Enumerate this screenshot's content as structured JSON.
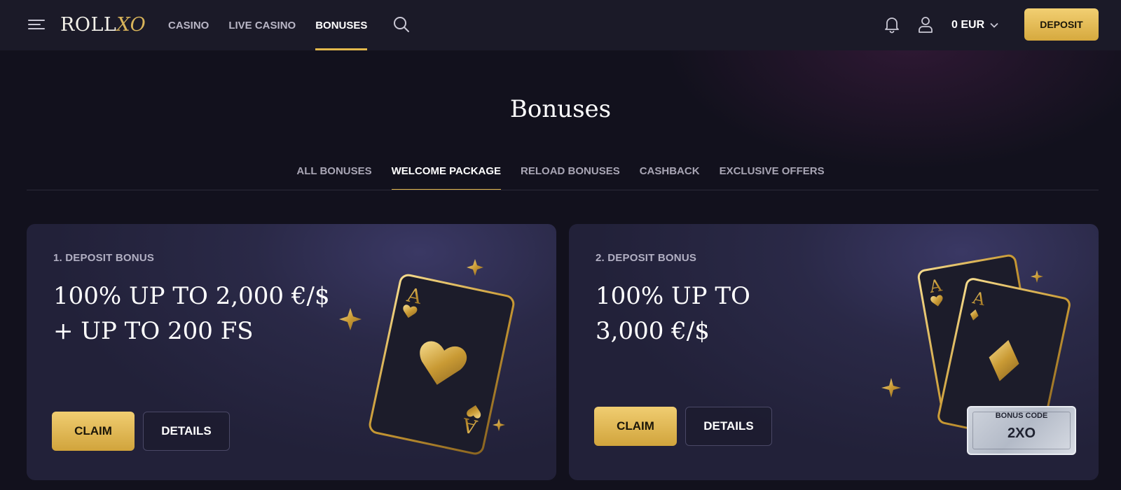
{
  "header": {
    "logo": {
      "roll": "ROLL",
      "xo": "XO"
    },
    "nav": [
      {
        "label": "CASINO",
        "active": false
      },
      {
        "label": "LIVE CASINO",
        "active": false
      },
      {
        "label": "BONUSES",
        "active": true
      }
    ],
    "balance": "0 EUR",
    "deposit_label": "DEPOSIT",
    "icons": [
      "menu-icon",
      "search-icon",
      "bell-icon",
      "user-icon",
      "chevron-down-icon"
    ]
  },
  "page": {
    "title": "Bonuses",
    "tabs": [
      {
        "label": "ALL BONUSES",
        "active": false
      },
      {
        "label": "WELCOME PACKAGE",
        "active": true
      },
      {
        "label": "RELOAD BONUSES",
        "active": false
      },
      {
        "label": "CASHBACK",
        "active": false
      },
      {
        "label": "EXCLUSIVE OFFERS",
        "active": false
      }
    ]
  },
  "cards": [
    {
      "label": "1. DEPOSIT BONUS",
      "offer": "100% UP TO 2,000 €/$\n+ UP TO 200 FS",
      "claim_label": "CLAIM",
      "details_label": "DETAILS",
      "art": "ace-of-hearts-card"
    },
    {
      "label": "2. DEPOSIT BONUS",
      "offer": "100% UP TO\n3,000 €/$",
      "claim_label": "CLAIM",
      "details_label": "DETAILS",
      "art": "ace-of-hearts-and-diamonds-cards",
      "bonus_code_label": "BONUS CODE",
      "bonus_code": "2XO"
    }
  ],
  "colors": {
    "accent_gold": "#e2b84c",
    "background": "#12111d",
    "topbar": "#1b1a28",
    "card": "#2a2947"
  }
}
